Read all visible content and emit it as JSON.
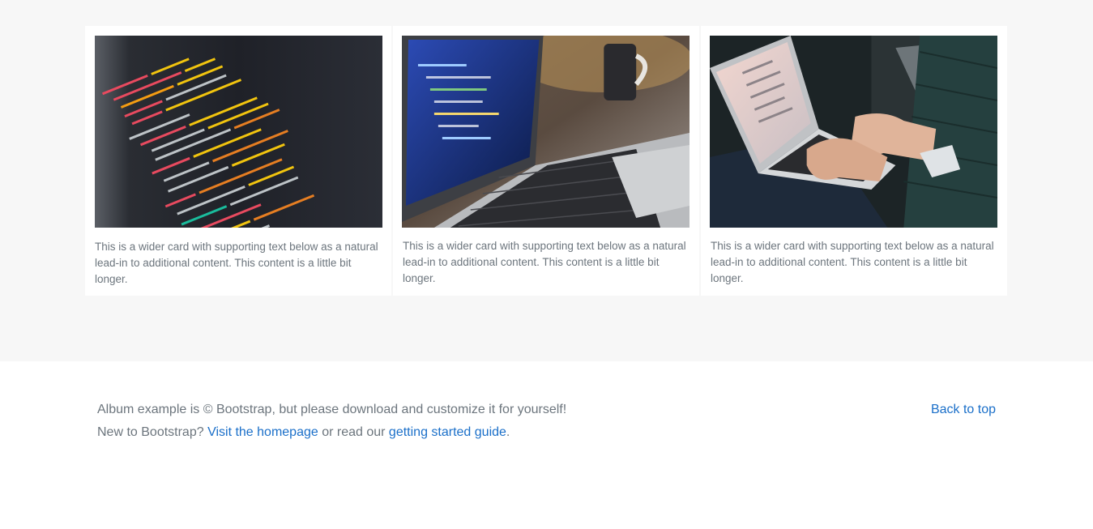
{
  "cards": [
    {
      "image_icon": "code-screen-photo",
      "text": "This is a wider card with supporting text below as a natural lead-in to additional content. This content is a little bit longer."
    },
    {
      "image_icon": "laptop-coding-photo",
      "text": "This is a wider card with supporting text below as a natural lead-in to additional content. This content is a little bit longer."
    },
    {
      "image_icon": "typing-on-laptop-photo",
      "text": "This is a wider card with supporting text below as a natural lead-in to additional content. This content is a little bit longer."
    }
  ],
  "footer": {
    "line1": "Album example is © Bootstrap, but please download and customize it for yourself!",
    "line2_prefix": "New to Bootstrap? ",
    "homepage_link": "Visit the homepage",
    "line2_middle": " or read our ",
    "guide_link": "getting started guide",
    "line2_suffix": ".",
    "back_to_top": "Back to top"
  },
  "colors": {
    "album_bg": "#f7f7f7",
    "text_muted": "#6c757d",
    "link": "#1a6fc9"
  }
}
